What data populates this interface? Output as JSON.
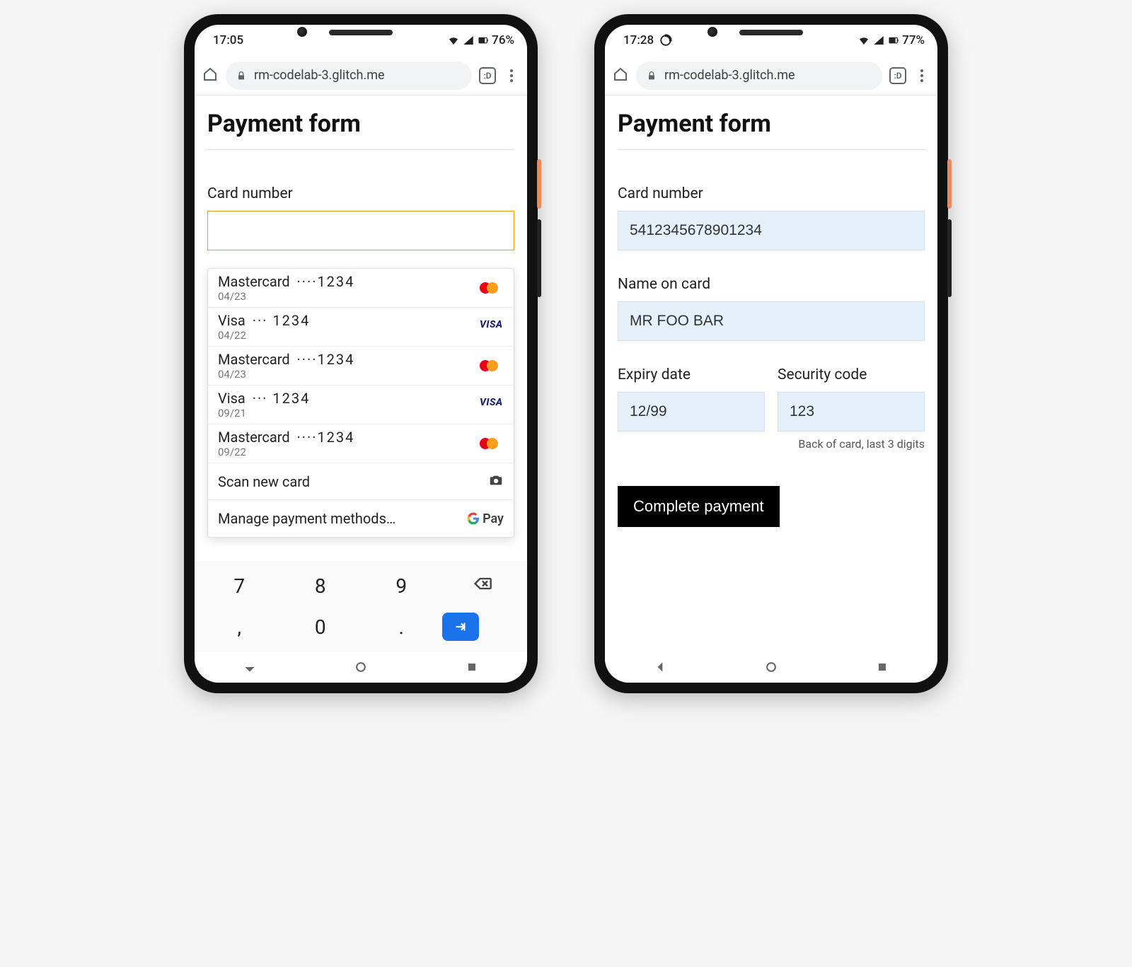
{
  "phone1": {
    "status": {
      "time": "17:05",
      "battery": "76%"
    },
    "url": "rm-codelab-3.glitch.me",
    "tab_count": ":D",
    "page_title": "Payment form",
    "card_number_label": "Card number",
    "autofill": {
      "cards": [
        {
          "brand": "Mastercard",
          "mask": "····1234",
          "exp": "04/23",
          "type": "mc"
        },
        {
          "brand": "Visa",
          "mask": "··· 1234",
          "exp": "04/22",
          "type": "visa"
        },
        {
          "brand": "Mastercard",
          "mask": "····1234",
          "exp": "04/23",
          "type": "mc"
        },
        {
          "brand": "Visa",
          "mask": "··· 1234",
          "exp": "09/21",
          "type": "visa"
        },
        {
          "brand": "Mastercard",
          "mask": "····1234",
          "exp": "09/22",
          "type": "mc"
        }
      ],
      "scan_label": "Scan new card",
      "manage_label": "Manage payment methods…",
      "gpay_text": "Pay"
    },
    "keyboard": {
      "row1": [
        "7",
        "8",
        "9"
      ],
      "row2": [
        ",",
        "0",
        "."
      ]
    }
  },
  "phone2": {
    "status": {
      "time": "17:28",
      "battery": "77%"
    },
    "url": "rm-codelab-3.glitch.me",
    "tab_count": ":D",
    "page_title": "Payment form",
    "fields": {
      "card_number": {
        "label": "Card number",
        "value": "5412345678901234"
      },
      "name": {
        "label": "Name on card",
        "value": "MR FOO BAR"
      },
      "expiry": {
        "label": "Expiry date",
        "value": "12/99"
      },
      "cvc": {
        "label": "Security code",
        "value": "123",
        "help": "Back of card, last 3 digits"
      }
    },
    "submit_label": "Complete payment"
  }
}
